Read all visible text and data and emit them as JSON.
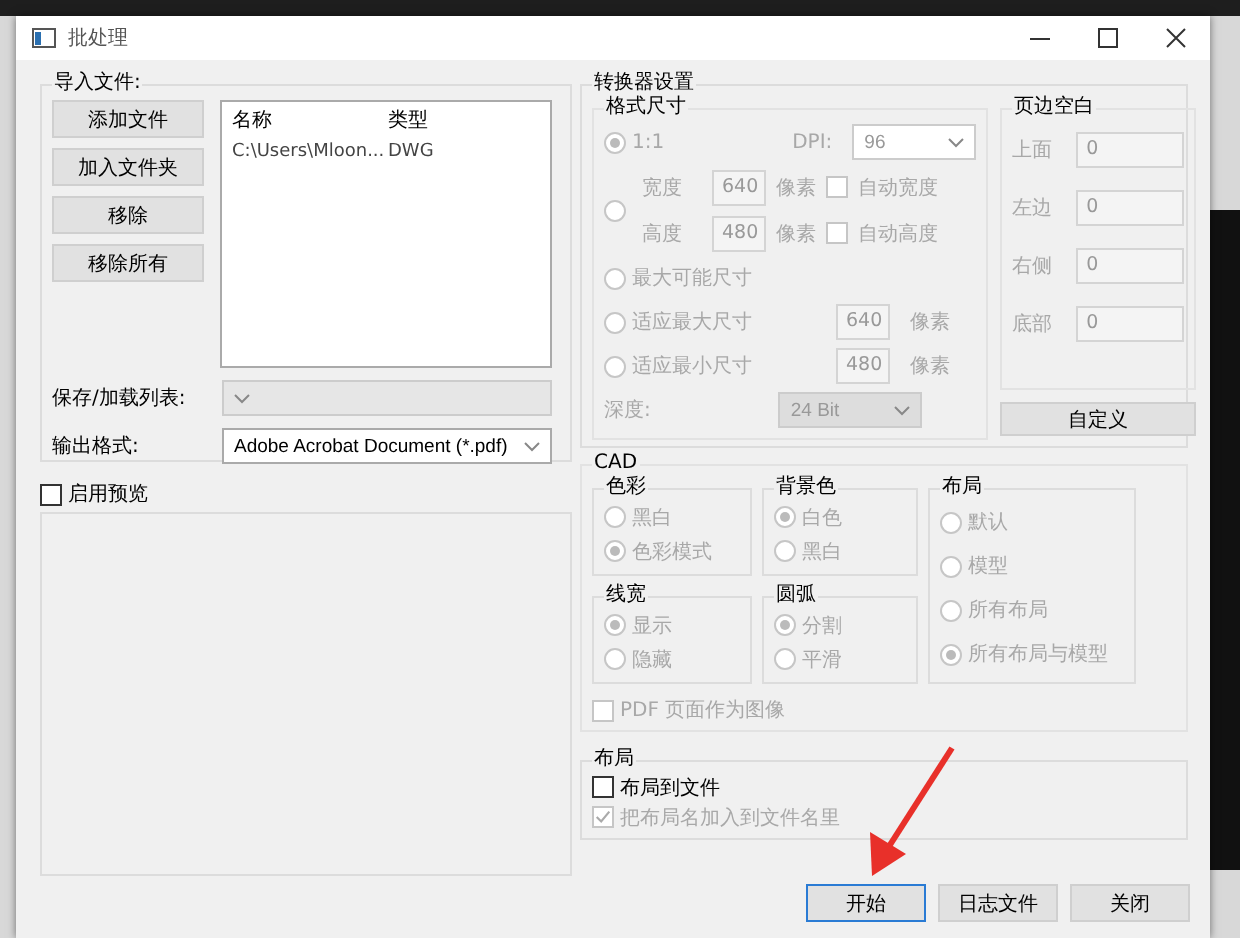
{
  "window": {
    "title": "批处理"
  },
  "import": {
    "title": "导入文件:",
    "buttons": [
      "添加文件",
      "加入文件夹",
      "移除",
      "移除所有"
    ],
    "columns": [
      "名称",
      "类型"
    ],
    "rows": [
      [
        "C:\\Users\\Mloon...",
        "DWG"
      ]
    ]
  },
  "save_list": {
    "label": "保存/加载列表:",
    "disabled": true
  },
  "output_format": {
    "label": "输出格式:",
    "value": "Adobe Acrobat Document (*.pdf)"
  },
  "preview": {
    "label": "启用预览",
    "checked": false
  },
  "converter": {
    "title": "转换器设置",
    "format_size": {
      "title": "格式尺寸",
      "disabled": true,
      "options": [
        {
          "kind": "ratio",
          "label": "1:1",
          "selected": true,
          "dpi_label": "DPI:",
          "dpi": "96"
        },
        {
          "kind": "custom",
          "selected": false,
          "rows": [
            {
              "label": "宽度",
              "value": "640",
              "unit": "像素",
              "auto_label": "自动宽度",
              "auto_checked": false
            },
            {
              "label": "高度",
              "value": "480",
              "unit": "像素",
              "auto_label": "自动高度",
              "auto_checked": false
            }
          ]
        },
        {
          "kind": "plain",
          "label": "最大可能尺寸",
          "selected": false
        },
        {
          "kind": "fit",
          "label": "适应最大尺寸",
          "selected": false,
          "value": "640",
          "unit": "像素"
        },
        {
          "kind": "fit",
          "label": "适应最小尺寸",
          "selected": false,
          "value": "480",
          "unit": "像素"
        }
      ],
      "depth": {
        "label": "深度:",
        "value": "24 Bit"
      }
    },
    "margins": {
      "title": "页边空白",
      "disabled": true,
      "fields": [
        {
          "label": "上面",
          "value": "0"
        },
        {
          "label": "左边",
          "value": "0"
        },
        {
          "label": "右侧",
          "value": "0"
        },
        {
          "label": "底部",
          "value": "0"
        }
      ],
      "button": "自定义"
    }
  },
  "cad": {
    "title": "CAD",
    "disabled": true,
    "groups": [
      {
        "title": "色彩",
        "options": [
          {
            "label": "黑白",
            "selected": false
          },
          {
            "label": "色彩模式",
            "selected": true
          }
        ]
      },
      {
        "title": "线宽",
        "options": [
          {
            "label": "显示",
            "selected": true
          },
          {
            "label": "隐藏",
            "selected": false
          }
        ]
      },
      {
        "title": "背景色",
        "options": [
          {
            "label": "白色",
            "selected": true
          },
          {
            "label": "黑白",
            "selected": false
          }
        ]
      },
      {
        "title": "圆弧",
        "options": [
          {
            "label": "分割",
            "selected": true
          },
          {
            "label": "平滑",
            "selected": false
          }
        ]
      },
      {
        "title": "布局",
        "options": [
          {
            "label": "默认",
            "selected": false
          },
          {
            "label": "模型",
            "selected": false
          },
          {
            "label": "所有布局",
            "selected": false
          },
          {
            "label": "所有布局与模型",
            "selected": true
          }
        ]
      }
    ],
    "pdf_as_image": {
      "label": "PDF 页面作为图像",
      "checked": false
    }
  },
  "layout": {
    "title": "布局",
    "options": [
      {
        "label": "布局到文件",
        "checked": false,
        "disabled": false
      },
      {
        "label": "把布局名加入到文件名里",
        "checked": true,
        "disabled": true
      }
    ]
  },
  "footer": {
    "buttons": [
      {
        "label": "开始",
        "focused": true
      },
      {
        "label": "日志文件",
        "focused": false
      },
      {
        "label": "关闭",
        "focused": false
      }
    ]
  }
}
